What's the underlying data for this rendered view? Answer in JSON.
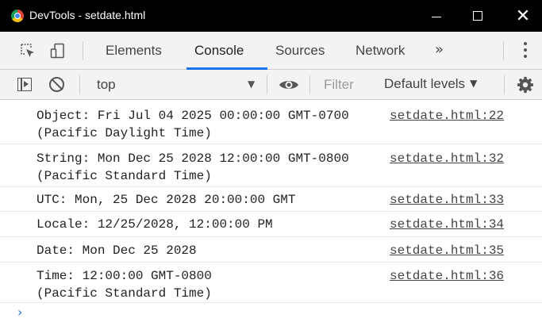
{
  "window": {
    "title": "DevTools - setdate.html",
    "app_icon": "chrome-icon",
    "minimize_icon": "minimize-icon",
    "maximize_icon": "maximize-icon",
    "close_glyph": "✕"
  },
  "tabs": {
    "items": [
      {
        "label": "Elements"
      },
      {
        "label": "Console",
        "active": true
      },
      {
        "label": "Sources"
      },
      {
        "label": "Network"
      }
    ],
    "more_glyph": "»",
    "accent_color": "#1a73e8"
  },
  "toolbar": {
    "context": "top",
    "dropdown_glyph": "▼",
    "filter_placeholder": "Filter",
    "levels_label": "Default levels",
    "levels_glyph": "▼"
  },
  "console": {
    "messages": [
      {
        "text": "Object: Fri Jul 04 2025 00:00:00 GMT-0700\n(Pacific Daylight Time)",
        "source": "setdate.html:22"
      },
      {
        "text": "String: Mon Dec 25 2028 12:00:00 GMT-0800\n(Pacific Standard Time)",
        "source": "setdate.html:32"
      },
      {
        "text": "UTC: Mon, 25 Dec 2028 20:00:00 GMT",
        "source": "setdate.html:33"
      },
      {
        "text": "Locale: 12/25/2028, 12:00:00 PM",
        "source": "setdate.html:34"
      },
      {
        "text": "Date: Mon Dec 25 2028",
        "source": "setdate.html:35"
      },
      {
        "text": "Time: 12:00:00 GMT-0800\n(Pacific Standard Time)",
        "source": "setdate.html:36"
      }
    ],
    "prompt_glyph": "›"
  }
}
